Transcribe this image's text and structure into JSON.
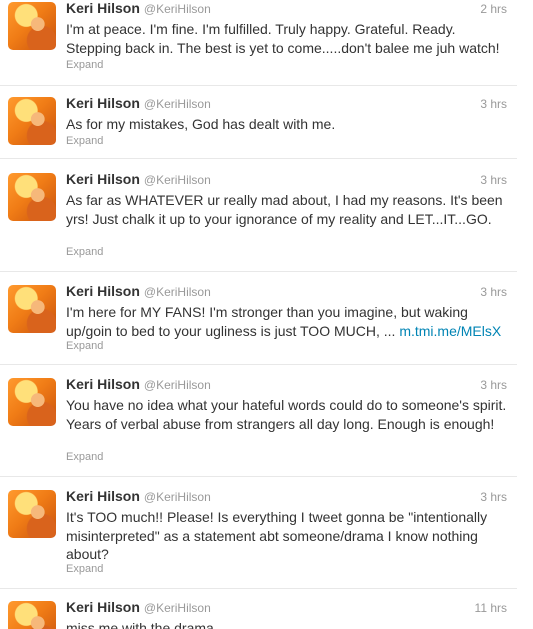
{
  "tweets": [
    {
      "name": "Keri Hilson",
      "handle": "@KeriHilson",
      "time": "2 hrs",
      "text": "I'm at peace. I'm fine. I'm fulfilled. Truly happy. Grateful. Ready. Stepping back in. The best is yet to come.....don't balee me juh watch!",
      "link": "",
      "expand": "Expand"
    },
    {
      "name": "Keri Hilson",
      "handle": "@KeriHilson",
      "time": "3 hrs",
      "text": "As for my mistakes, God has dealt with me.",
      "link": "",
      "expand": "Expand"
    },
    {
      "name": "Keri Hilson",
      "handle": "@KeriHilson",
      "time": "3 hrs",
      "text": "As far as WHATEVER ur really mad about, I had my reasons. It's been yrs! Just chalk it up to your ignorance of my reality and LET...IT...GO.",
      "link": "",
      "expand": "Expand"
    },
    {
      "name": "Keri Hilson",
      "handle": "@KeriHilson",
      "time": "3 hrs",
      "text": "I'm here for MY FANS! I'm stronger than you imagine, but waking up/goin to bed to your ugliness is just TOO MUCH, ...",
      "link": "m.tmi.me/MElsX",
      "expand": "Expand"
    },
    {
      "name": "Keri Hilson",
      "handle": "@KeriHilson",
      "time": "3 hrs",
      "text": "You have no idea what your hateful words could do to someone's spirit. Years of verbal abuse from strangers all day long. Enough is enough!",
      "link": "",
      "expand": "Expand"
    },
    {
      "name": "Keri Hilson",
      "handle": "@KeriHilson",
      "time": "3 hrs",
      "text": "It's TOO much!! Please! Is everything I tweet gonna be \"intentionally misinterpreted\" as a statement abt someone/drama I know nothing about?",
      "link": "",
      "expand": "Expand"
    },
    {
      "name": "Keri Hilson",
      "handle": "@KeriHilson",
      "time": "11 hrs",
      "text": "miss me with the drama",
      "link": "",
      "expand": ""
    }
  ]
}
